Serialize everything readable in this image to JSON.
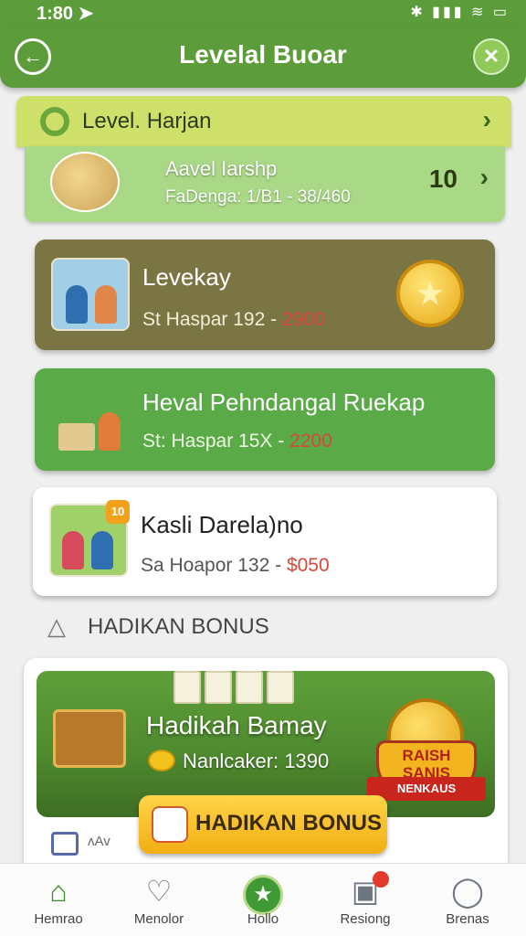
{
  "status_bar": {
    "time": "1:80 ➤",
    "icons": "✱ ▮▮▮ ≋ ▭"
  },
  "header": {
    "title": "Levelal Buoar"
  },
  "current_level": {
    "label": "Level. Harjan",
    "name": "Aavel Iarshp",
    "range": "FaDenga: 1/B1 - 38/460",
    "count": "10"
  },
  "levels": [
    {
      "name": "Levekay",
      "range_prefix": "St Haspar 192 - ",
      "points": "2900"
    },
    {
      "name": "Heval Pehndangal Ruekap",
      "range_prefix": "St: Haspar 15X - ",
      "points": "2200"
    },
    {
      "name": "Kasli Darela)no",
      "range_prefix": "Sa Hoapor 132 - ",
      "points": "$050",
      "badge": "10"
    }
  ],
  "section": {
    "title": "HADIKAN BONUS"
  },
  "bonus": {
    "banner_title": "Hadikah Bamay",
    "banner_value": "Nanlcaker: 1390",
    "emblem_text": "RAISH SANIS",
    "emblem_ribbon": "NENKAUS",
    "button_label": "HADIKAN BONUS",
    "footer_text": "ʌAv"
  },
  "bottom_nav": [
    {
      "label": "Hemrao"
    },
    {
      "label": "Menolor"
    },
    {
      "label": "Hollo"
    },
    {
      "label": "Resiong"
    },
    {
      "label": "Brenas"
    }
  ],
  "colors": {
    "primary_green": "#5d9c3a",
    "olive_card": "#7b7543",
    "green_card": "#5aaa47",
    "points_red": "#d9463c",
    "gold": "#f0ae12"
  }
}
